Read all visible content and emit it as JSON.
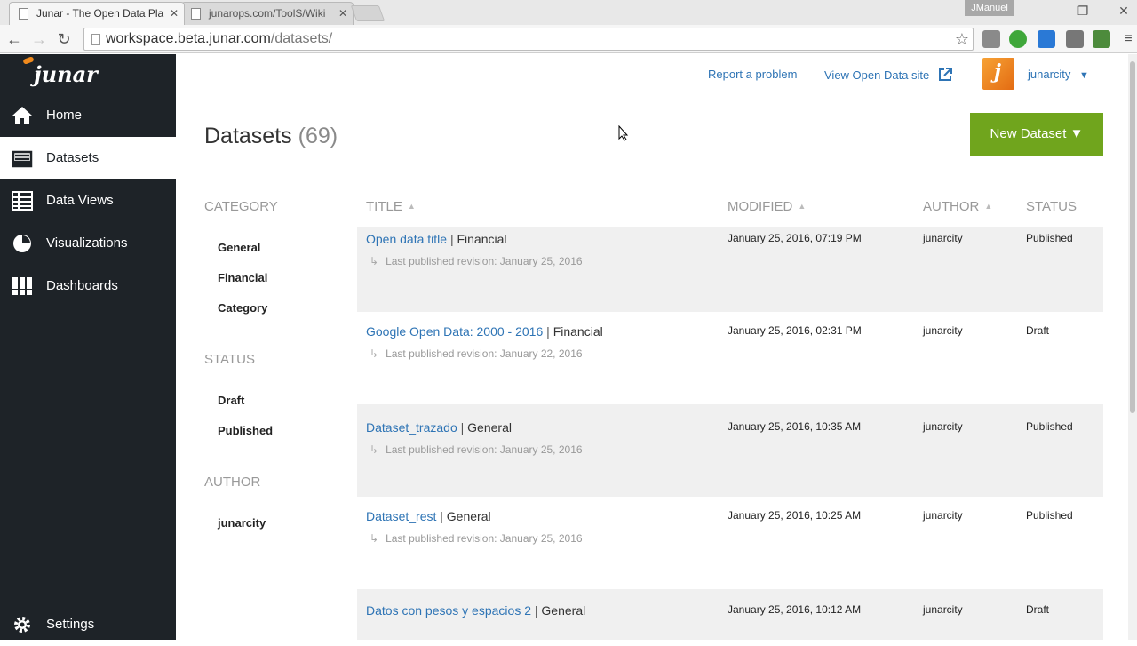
{
  "browser": {
    "tabs": [
      {
        "label": "Junar - The Open Data Pla",
        "active": true
      },
      {
        "label": "junarops.com/ToolS/Wiki",
        "active": false
      }
    ],
    "window_user": "JManuel",
    "url_host": "workspace.beta.junar.com",
    "url_path": "/datasets/"
  },
  "sidebar": {
    "logo_text": "junar",
    "items": [
      {
        "label": "Home",
        "icon": "home-icon",
        "active": false
      },
      {
        "label": "Datasets",
        "icon": "datasets-icon",
        "active": true
      },
      {
        "label": "Data Views",
        "icon": "table-icon",
        "active": false
      },
      {
        "label": "Visualizations",
        "icon": "pie-chart-icon",
        "active": false
      },
      {
        "label": "Dashboards",
        "icon": "grid-icon",
        "active": false
      }
    ],
    "settings_label": "Settings"
  },
  "header": {
    "report_link": "Report a problem",
    "view_site_link": "View Open Data site",
    "username": "junarcity",
    "caret": "▼"
  },
  "page": {
    "title": "Datasets",
    "count": "(69)",
    "new_button": "New Dataset ▼"
  },
  "facets": {
    "category_title": "CATEGORY",
    "categories": [
      "General",
      "Financial",
      "Category"
    ],
    "status_title": "STATUS",
    "statuses": [
      "Draft",
      "Published"
    ],
    "author_title": "AUTHOR",
    "authors": [
      "junarcity"
    ]
  },
  "table": {
    "headers": {
      "title": "TITLE",
      "modified": "MODIFIED",
      "author": "AUTHOR",
      "status": "STATUS"
    },
    "rows": [
      {
        "title": "Open data title",
        "category": "Financial",
        "revision": "Last published revision: January 25, 2016",
        "modified": "January 25, 2016, 07:19 PM",
        "author": "junarcity",
        "status": "Published"
      },
      {
        "title": "Google Open Data: 2000 - 2016",
        "category": "Financial",
        "revision": "Last published revision: January 22, 2016",
        "modified": "January 25, 2016, 02:31 PM",
        "author": "junarcity",
        "status": "Draft"
      },
      {
        "title": "Dataset_trazado",
        "category": "General",
        "revision": "Last published revision: January 25, 2016",
        "modified": "January 25, 2016, 10:35 AM",
        "author": "junarcity",
        "status": "Published"
      },
      {
        "title": "Dataset_rest",
        "category": "General",
        "revision": "Last published revision: January 25, 2016",
        "modified": "January 25, 2016, 10:25 AM",
        "author": "junarcity",
        "status": "Published"
      },
      {
        "title": "Datos con pesos y espacios 2",
        "category": "General",
        "revision": "",
        "modified": "January 25, 2016, 10:12 AM",
        "author": "junarcity",
        "status": "Draft"
      }
    ]
  },
  "colors": {
    "accent": "#70a51d",
    "link": "#2e74b5",
    "sidebar": "#1e2328",
    "avatar": "#f08a1d"
  }
}
